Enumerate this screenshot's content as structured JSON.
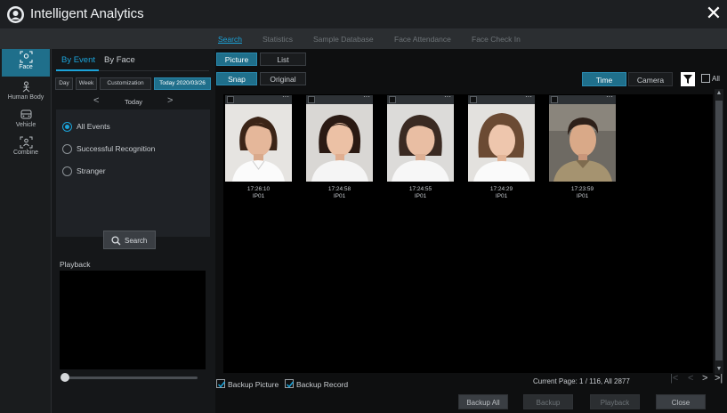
{
  "window": {
    "title": "Intelligent Analytics",
    "close_symbol": "✕"
  },
  "top_tabs": [
    {
      "label": "Search",
      "active": true
    },
    {
      "label": "Statistics",
      "active": false
    },
    {
      "label": "Sample Database",
      "active": false
    },
    {
      "label": "Face Attendance",
      "active": false
    },
    {
      "label": "Face Check In",
      "active": false
    }
  ],
  "sidebar": {
    "items": [
      {
        "label": "Face",
        "icon": "face-icon",
        "active": true
      },
      {
        "label": "Human Body",
        "icon": "human-body-icon",
        "active": false
      },
      {
        "label": "Vehicle",
        "icon": "vehicle-icon",
        "active": false
      },
      {
        "label": "Combine",
        "icon": "combine-icon",
        "active": false
      }
    ]
  },
  "filter": {
    "subtabs": [
      {
        "label": "By Event",
        "active": true
      },
      {
        "label": "By Face",
        "active": false
      }
    ],
    "ranges": [
      {
        "label": "Day",
        "active": false
      },
      {
        "label": "Week",
        "active": false
      },
      {
        "label": "Customization",
        "active": false
      },
      {
        "label": "Today 2020/03/26",
        "active": true
      }
    ],
    "date_label": "Today",
    "prev_symbol": "<",
    "next_symbol": ">",
    "events": [
      {
        "label": "All Events",
        "checked": true
      },
      {
        "label": "Successful Recognition",
        "checked": false
      },
      {
        "label": "Stranger",
        "checked": false
      }
    ],
    "search_label": "Search"
  },
  "playback": {
    "title": "Playback",
    "position": 0
  },
  "main": {
    "view_modes": [
      {
        "label": "Picture",
        "active": true
      },
      {
        "label": "List",
        "active": false
      }
    ],
    "image_modes": [
      {
        "label": "Snap",
        "active": true
      },
      {
        "label": "Original",
        "active": false
      }
    ],
    "sort_modes": [
      {
        "label": "Time",
        "active": true
      },
      {
        "label": "Camera",
        "active": false
      }
    ],
    "all_label": "All",
    "results": [
      {
        "time": "17:26:10",
        "channel": "IP01",
        "icon": "face-thumbnail"
      },
      {
        "time": "17:24:58",
        "channel": "IP01",
        "icon": "face-thumbnail"
      },
      {
        "time": "17:24:55",
        "channel": "IP01",
        "icon": "face-thumbnail"
      },
      {
        "time": "17:24:29",
        "channel": "IP01",
        "icon": "face-thumbnail"
      },
      {
        "time": "17:23:59",
        "channel": "IP01",
        "icon": "face-thumbnail"
      }
    ],
    "more_symbol": "···",
    "backup_picture_label": "Backup Picture",
    "backup_record_label": "Backup Record",
    "backup_picture_checked": true,
    "backup_record_checked": true,
    "page_info": "Current Page: 1 / 116, All 2877",
    "pager": {
      "first": "|<",
      "prev": "<",
      "next": ">",
      "last": ">|"
    },
    "buttons": [
      {
        "label": "Backup All",
        "enabled": true
      },
      {
        "label": "Backup",
        "enabled": false
      },
      {
        "label": "Playback",
        "enabled": false
      },
      {
        "label": "Close",
        "enabled": true
      }
    ]
  },
  "colors": {
    "accent": "#1ba3d9",
    "active_bg": "#1f6f8b"
  }
}
